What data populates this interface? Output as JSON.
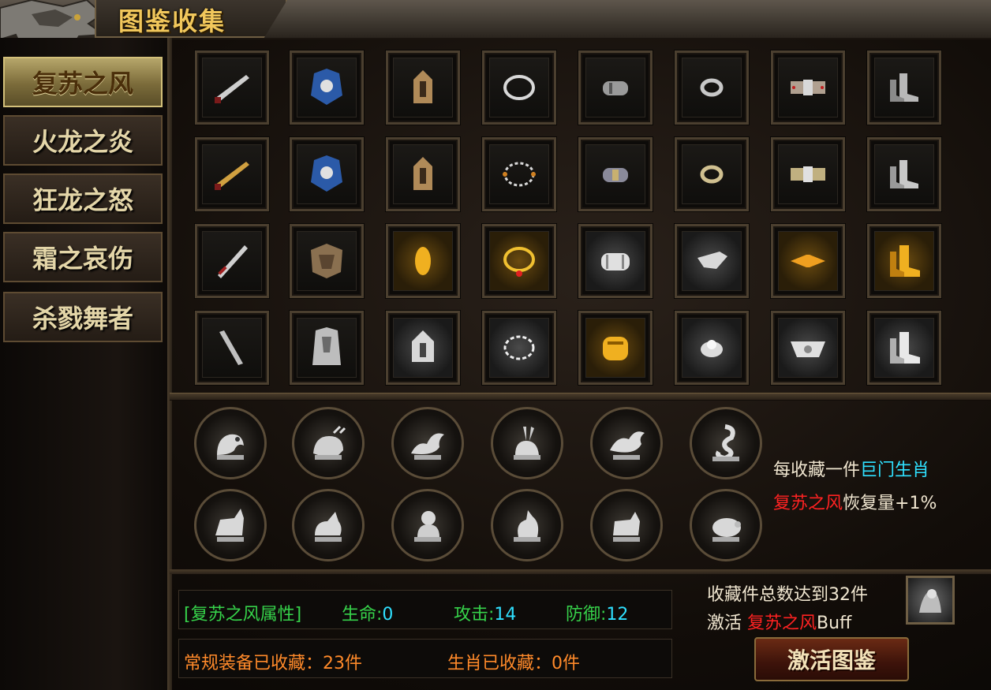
{
  "window": {
    "title": "图鉴收集"
  },
  "tabs": [
    {
      "label": "复苏之风",
      "active": true
    },
    {
      "label": "火龙之炎",
      "active": false
    },
    {
      "label": "狂龙之怒",
      "active": false
    },
    {
      "label": "霜之哀伤",
      "active": false
    },
    {
      "label": "杀戮舞者",
      "active": false
    }
  ],
  "equipment_grid": {
    "rows": [
      [
        "blade-icon",
        "armor-blue-icon",
        "helmet-icon",
        "necklace-icon",
        "bracer-icon",
        "ring-icon",
        "belt-icon",
        "boots-icon"
      ],
      [
        "blade-gold-icon",
        "armor-blue-icon",
        "helmet-icon",
        "necklace-beads-icon",
        "bracer-icon",
        "ring-icon",
        "belt-icon",
        "boots-icon"
      ],
      [
        "sword-icon",
        "armor-dark-icon",
        "helmet-gold-icon",
        "necklace-gold-icon",
        "bracer-silver-icon",
        "ring-silver-icon",
        "belt-gold-icon",
        "boots-gold-icon"
      ],
      [
        "greatsword-icon",
        "armor-silver-icon",
        "helmet-silver-icon",
        "necklace-silver-icon",
        "bracer-gold-icon",
        "ring-silver-icon",
        "belt-silver-icon",
        "boots-silver-icon"
      ]
    ]
  },
  "zodiac_grid": {
    "rows": [
      [
        "rat-icon",
        "ox-icon",
        "dragon-icon",
        "rabbit-icon",
        "dragon-icon",
        "snake-icon"
      ],
      [
        "horse-icon",
        "goat-icon",
        "monkey-icon",
        "rooster-icon",
        "dog-icon",
        "pig-icon"
      ]
    ]
  },
  "zodiac_info": {
    "line1_prefix": "每收藏一件",
    "line1_highlight": "巨门生肖",
    "line2_highlight": "复苏之风",
    "line2_suffix": "恢复量+1%"
  },
  "attributes": {
    "label": "[复苏之风属性]",
    "hp_label": "生命:",
    "hp_value": "0",
    "atk_label": "攻击:",
    "atk_value": "14",
    "def_label": "防御:",
    "def_value": "12"
  },
  "collection": {
    "equip_text": "常规装备已收藏：23件",
    "zodiac_text": "生肖已收藏：0件"
  },
  "buff": {
    "line1": "收藏件总数达到32件",
    "line2_prefix": "激活",
    "line2_highlight": "复苏之风",
    "line2_suffix": "Buff"
  },
  "buttons": {
    "activate": "激活图鉴"
  }
}
